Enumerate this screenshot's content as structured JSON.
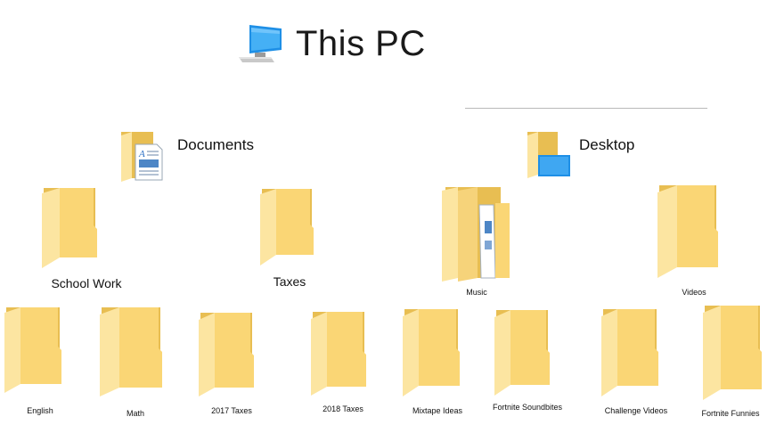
{
  "title": "This PC",
  "icons": {
    "pc": "computer-icon",
    "folder": "folder-icon",
    "documents": "documents-folder-icon",
    "desktop": "desktop-folder-icon",
    "music": "music-folder-icon"
  },
  "colors": {
    "folder_front": "#FCE5A1",
    "folder_back": "#E8BE52",
    "monitor_blue": "#1E8FE6"
  },
  "nodes": {
    "documents": "Documents",
    "desktop": "Desktop",
    "school_work": "School Work",
    "taxes": "Taxes",
    "music": "Music",
    "videos": "Videos",
    "english": "English",
    "math": "Math",
    "taxes_2017": "2017 Taxes",
    "taxes_2018": "2018 Taxes",
    "mixtape_ideas": "Mixtape Ideas",
    "fortnite_soundbites": "Fortnite Soundbites",
    "challenge_videos": "Challenge Videos",
    "fortnite_funnies": "Fortnite Funnies"
  }
}
